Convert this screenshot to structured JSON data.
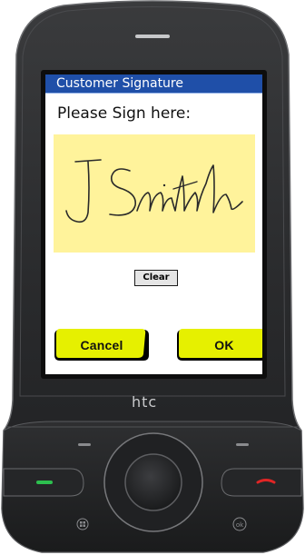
{
  "device": {
    "brand": "htc",
    "colors": {
      "body": "#2b2c2e",
      "bezel": "#202123",
      "screen_border": "#0d0d0d",
      "call_green": "#2dbf4f",
      "end_red": "#e02525"
    }
  },
  "app": {
    "title": "Customer Signature",
    "prompt": "Please Sign here:",
    "signature_text": "J Smith",
    "clear_label": "Clear",
    "cancel_label": "Cancel",
    "ok_label": "OK",
    "colors": {
      "titlebar": "#1f4fa8",
      "pad": "#fff39b",
      "button_yellow": "#e6f000"
    }
  }
}
